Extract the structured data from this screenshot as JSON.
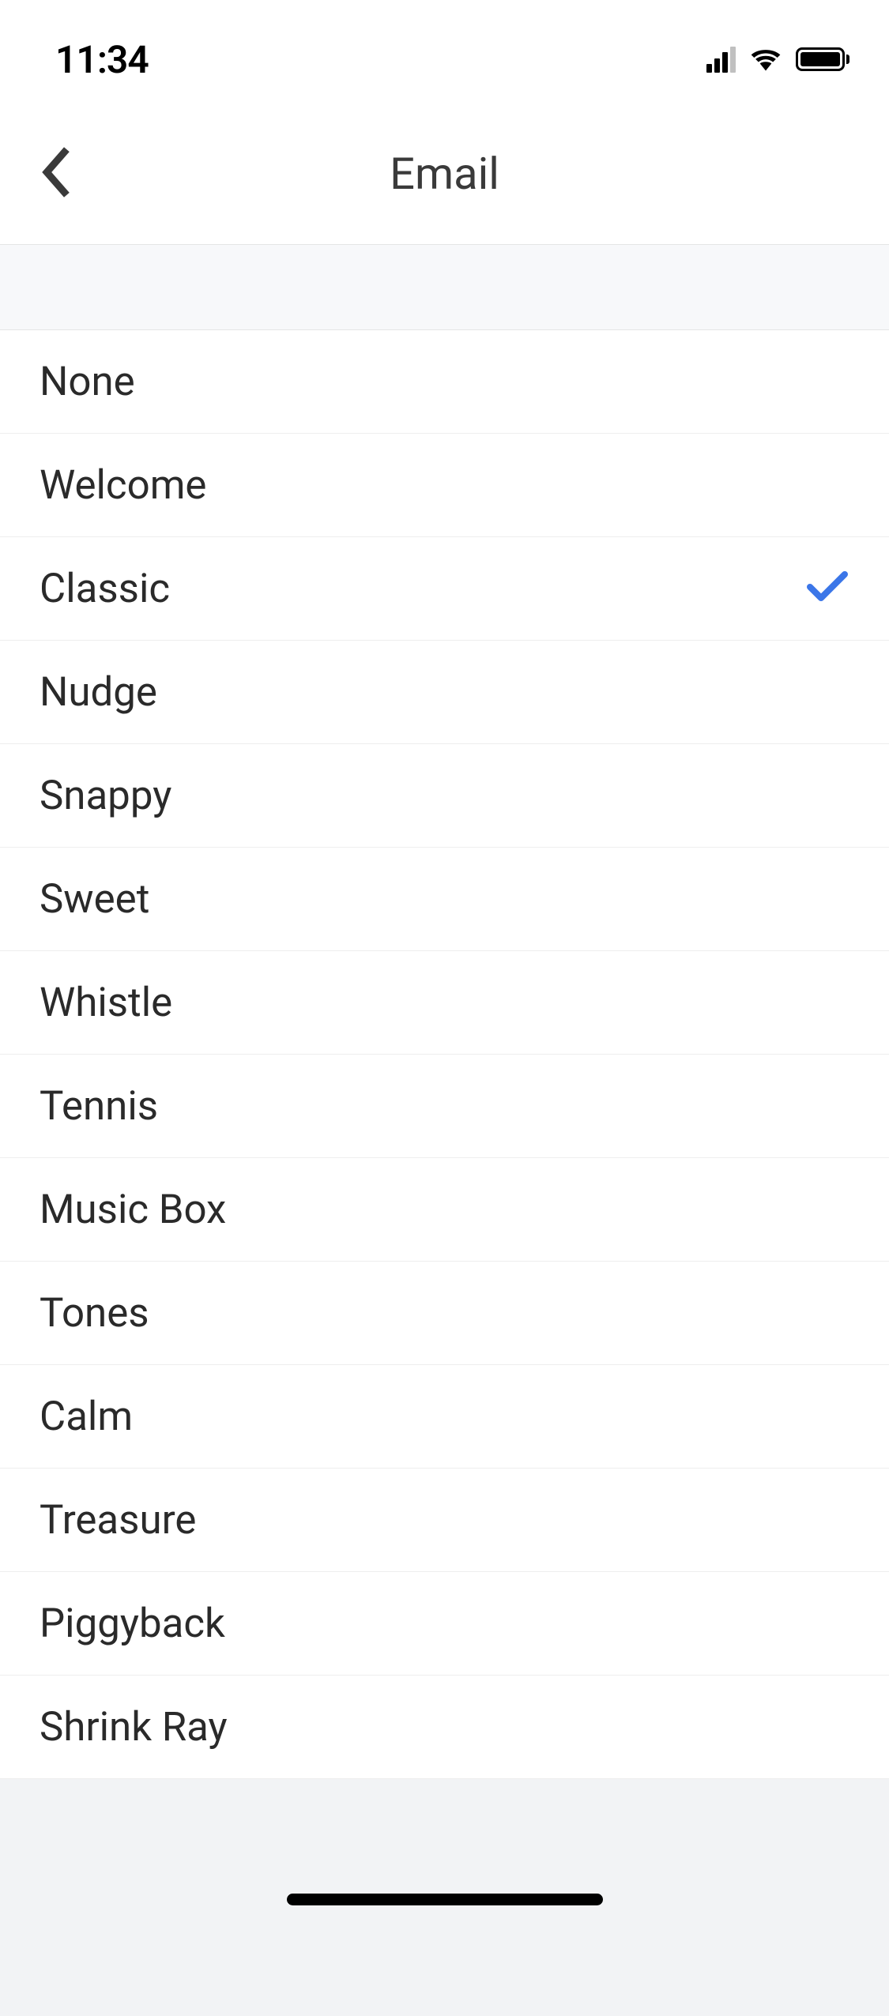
{
  "status_bar": {
    "time": "11:34"
  },
  "header": {
    "title": "Email"
  },
  "sounds": [
    {
      "label": "None",
      "selected": false
    },
    {
      "label": "Welcome",
      "selected": false
    },
    {
      "label": "Classic",
      "selected": true
    },
    {
      "label": "Nudge",
      "selected": false
    },
    {
      "label": "Snappy",
      "selected": false
    },
    {
      "label": "Sweet",
      "selected": false
    },
    {
      "label": "Whistle",
      "selected": false
    },
    {
      "label": "Tennis",
      "selected": false
    },
    {
      "label": "Music Box",
      "selected": false
    },
    {
      "label": "Tones",
      "selected": false
    },
    {
      "label": "Calm",
      "selected": false
    },
    {
      "label": "Treasure",
      "selected": false
    },
    {
      "label": "Piggyback",
      "selected": false
    },
    {
      "label": "Shrink Ray",
      "selected": false
    }
  ]
}
